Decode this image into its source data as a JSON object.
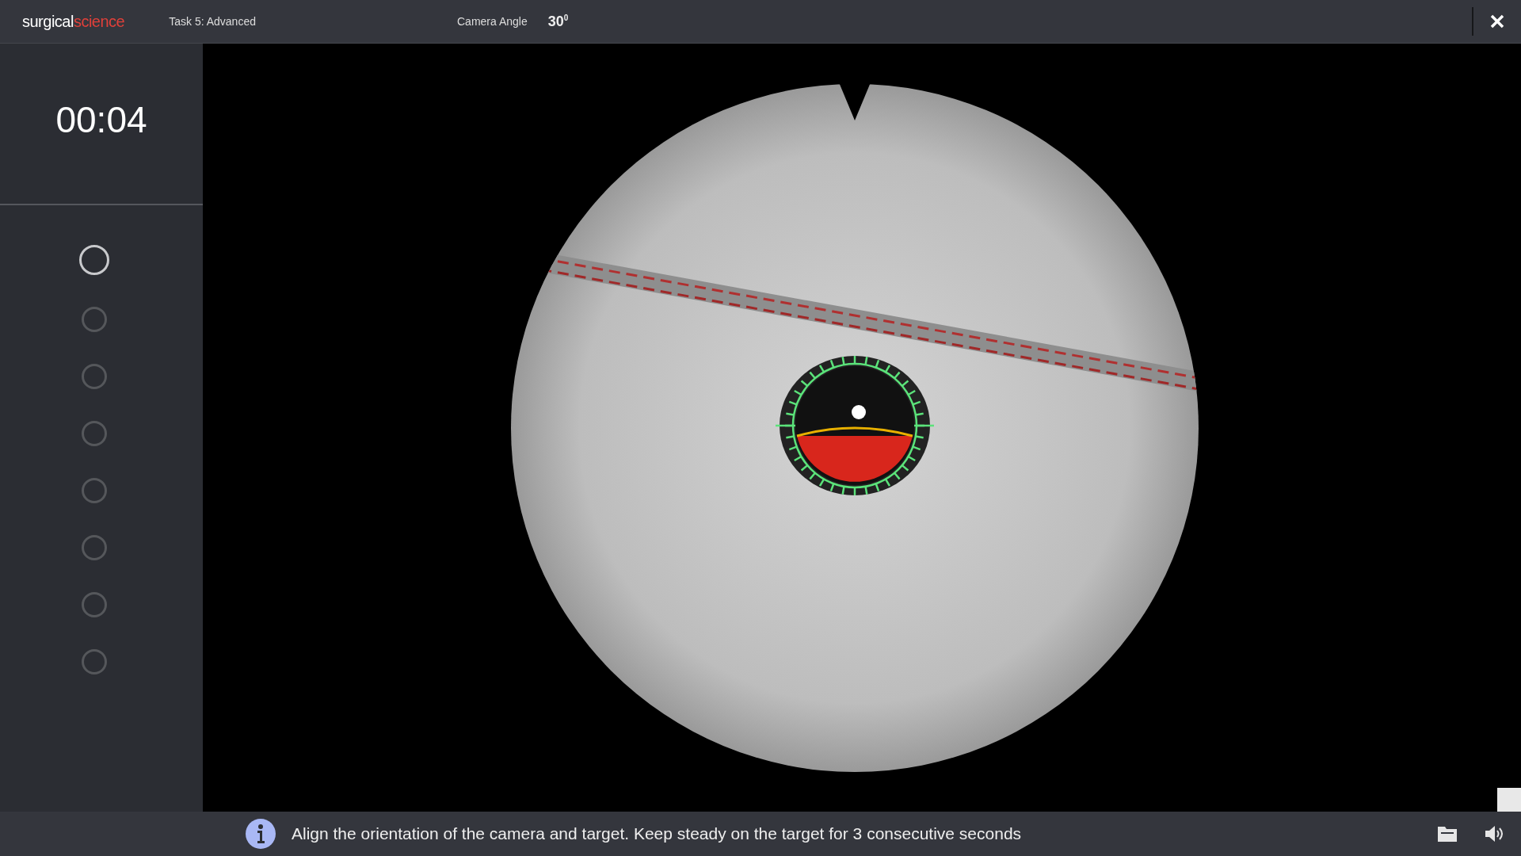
{
  "header": {
    "logo": {
      "part_1": "surgical",
      "part_2": "science"
    },
    "task": "Task 5: Advanced",
    "camera_angle_label": "Camera Angle",
    "camera_angle_value": "30$^{0}$"
  },
  "sidebar": {
    "timer": "00:04",
    "steps": [
      {
        "active": true
      },
      {
        "active": false
      },
      {
        "active": false
      },
      {
        "active": false
      },
      {
        "active": false
      },
      {
        "active": false
      },
      {
        "active": false
      },
      {
        "active": false
      }
    ]
  },
  "status_bar": {
    "message": "Align the orientation of the camera and target. Keep steady on the target for 3 consecutive seconds"
  }
}
